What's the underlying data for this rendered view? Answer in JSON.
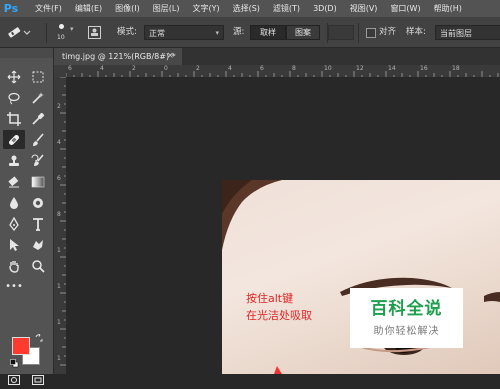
{
  "app": {
    "logo": "Ps"
  },
  "menu": [
    "文件(F)",
    "编辑(E)",
    "图像(I)",
    "图层(L)",
    "文字(Y)",
    "选择(S)",
    "滤镜(T)",
    "3D(D)",
    "视图(V)",
    "窗口(W)",
    "帮助(H)"
  ],
  "options": {
    "brush_size": "10",
    "mode_label": "模式:",
    "mode_value": "正常",
    "source_label": "源:",
    "source_sampled": "取样",
    "source_pattern": "图案",
    "aligned_label": "对齐",
    "sample_label": "样本:",
    "sample_value": "当前图层"
  },
  "document": {
    "tab_title": "timg.jpg @ 121%(RGB/8#) *",
    "close": "×"
  },
  "ruler": {
    "top": [
      "6",
      "4",
      "2",
      "0",
      "2",
      "4",
      "6",
      "8",
      "10",
      "12",
      "14",
      "16",
      "18"
    ],
    "left": [
      "2",
      "4",
      "6",
      "8",
      "1",
      "1",
      "1",
      "1"
    ]
  },
  "colors": {
    "foreground": "#ff3b30",
    "background": "#ffffff",
    "accent": "#31a8ff"
  },
  "annotation": {
    "line1": "按住alt键",
    "line2": "在光洁处吸取"
  },
  "watermark": {
    "title": "百科全说",
    "subtitle": "助你轻松解决"
  }
}
